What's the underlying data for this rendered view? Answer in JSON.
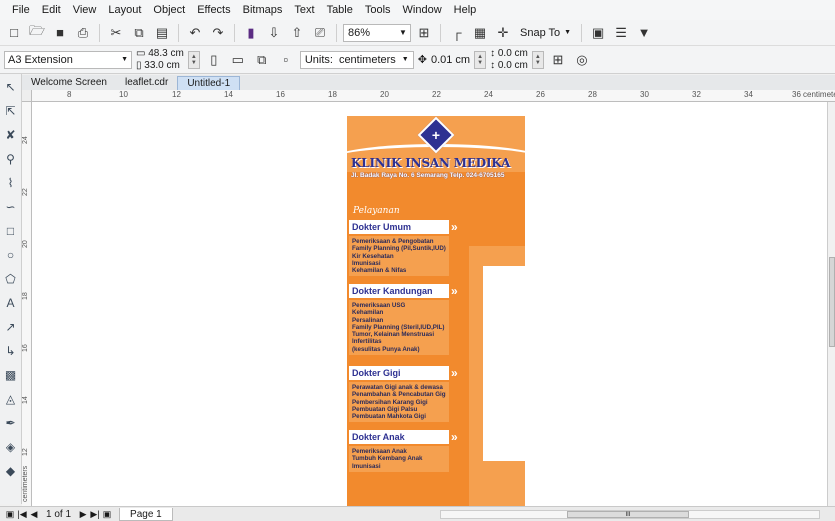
{
  "menu": [
    "File",
    "Edit",
    "View",
    "Layout",
    "Object",
    "Effects",
    "Bitmaps",
    "Text",
    "Table",
    "Tools",
    "Window",
    "Help"
  ],
  "toolbar": {
    "zoom": "86%",
    "snap_to": "Snap To"
  },
  "property_bar": {
    "page_size": "A3 Extension",
    "width": "48.3 cm",
    "height": "33.0 cm",
    "units_label": "Units:",
    "units_value": "centimeters",
    "nudge": "0.01 cm",
    "dup_x": "0.0 cm",
    "dup_y": "0.0 cm"
  },
  "doc_tabs": [
    "Welcome Screen",
    "leaflet.cdr",
    "Untitled-1"
  ],
  "ruler": {
    "h_ticks": [
      "8",
      "10",
      "12",
      "14",
      "16",
      "18",
      "20",
      "22",
      "24",
      "26",
      "28",
      "30",
      "32",
      "34",
      "36"
    ],
    "h_unit": "centimeters",
    "v_ticks": [
      "24",
      "22",
      "20",
      "18",
      "16",
      "14",
      "12"
    ],
    "v_unit": "centimeters"
  },
  "leaflet": {
    "title": "KLINIK INSAN MEDIKA",
    "address": "Jl. Badak Raya No. 6 Semarang Telp. 024-6705165",
    "pelayanan": "Pelayanan",
    "sections": [
      {
        "title": "Dokter Umum",
        "lines": [
          "Pemeriksaan & Pengobatan",
          "Family Planning (Pil,Suntik,IUD)",
          "Kir Kesehatan",
          "Imunisasi",
          "Kehamilan & Nifas"
        ]
      },
      {
        "title": "Dokter Kandungan",
        "lines": [
          "Pemeriksaan USG",
          "Kehamilan",
          "Persalinan",
          "Family Planning (Steril,IUD,PIL)",
          "Tumor, Kelainan Menstruasi",
          "Infertilitas",
          "(kesulitas Punya Anak)"
        ]
      },
      {
        "title": "Dokter Gigi",
        "lines": [
          "Perawatan Gigi anak & dewasa",
          "Penambahan & Pencabutan Gigi",
          "Pembersihan Karang Gigi",
          "Pembuatan Gigi Palsu",
          "Pembuatan Mahkota Gigi"
        ]
      },
      {
        "title": "Dokter Anak",
        "lines": [
          "Pemeriksaan Anak",
          "Tumbuh Kembang Anak",
          "Imunisasi"
        ]
      }
    ]
  },
  "page_nav": {
    "count": "1 of 1",
    "page_tab": "Page 1"
  },
  "colors": {
    "leaflet_orange": "#f28a2d",
    "leaflet_light_orange": "#f5a04f",
    "leaflet_blue": "#2e3192"
  }
}
